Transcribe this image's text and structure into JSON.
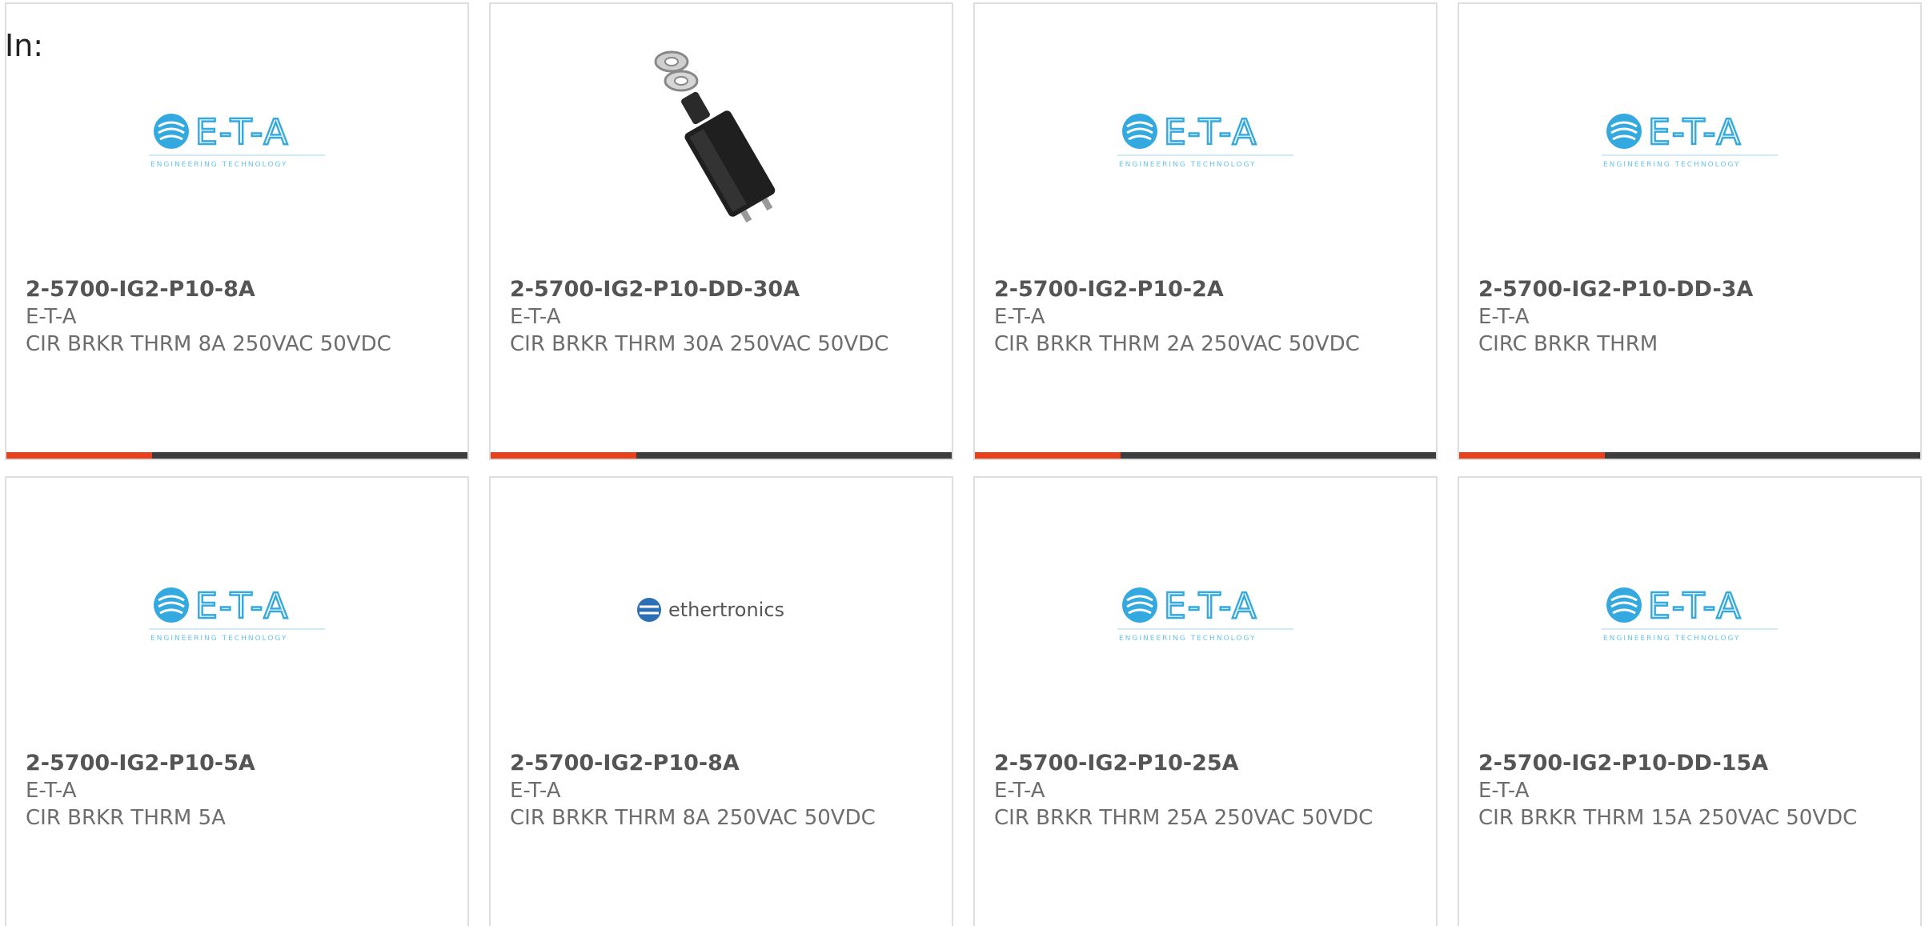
{
  "header": {
    "in_label": "In:"
  },
  "colors": {
    "accent": "#e8401a",
    "bar": "#3d3d3d",
    "eta_logo": "#33a9e0"
  },
  "products": [
    {
      "image": "eta-logo",
      "part_number": "2-5700-IG2-P10-8A",
      "manufacturer": "E-T-A",
      "description": "CIR BRKR THRM 8A 250VAC 50VDC"
    },
    {
      "image": "product-photo",
      "part_number": "2-5700-IG2-P10-DD-30A",
      "manufacturer": "E-T-A",
      "description": "CIR BRKR THRM 30A 250VAC 50VDC"
    },
    {
      "image": "eta-logo",
      "part_number": "2-5700-IG2-P10-2A",
      "manufacturer": "E-T-A",
      "description": "CIR BRKR THRM 2A 250VAC 50VDC"
    },
    {
      "image": "eta-logo",
      "part_number": "2-5700-IG2-P10-DD-3A",
      "manufacturer": "E-T-A",
      "description": "CIRC BRKR THRM"
    },
    {
      "image": "eta-logo",
      "part_number": "2-5700-IG2-P10-5A",
      "manufacturer": "E-T-A",
      "description": "CIR BRKR THRM 5A"
    },
    {
      "image": "ethertronics-logo",
      "part_number": "2-5700-IG2-P10-8A",
      "manufacturer": "E-T-A",
      "description": "CIR BRKR THRM 8A 250VAC 50VDC"
    },
    {
      "image": "eta-logo",
      "part_number": "2-5700-IG2-P10-25A",
      "manufacturer": "E-T-A",
      "description": "CIR BRKR THRM 25A 250VAC 50VDC"
    },
    {
      "image": "eta-logo",
      "part_number": "2-5700-IG2-P10-DD-15A",
      "manufacturer": "E-T-A",
      "description": "CIR BRKR THRM 15A 250VAC 50VDC"
    }
  ],
  "logos": {
    "eta_text": "E-T-A",
    "eta_tagline": "ENGINEERING TECHNOLOGY",
    "ethertronics_text": "ethertronics"
  }
}
